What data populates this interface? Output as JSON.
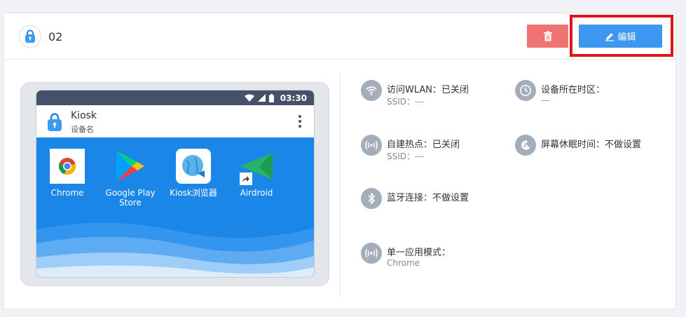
{
  "profile": {
    "name": "02"
  },
  "header": {
    "edit_label": "编辑"
  },
  "tablet": {
    "time": "03:30",
    "app_title": "Kiosk",
    "app_subtitle": "设备名",
    "apps": [
      {
        "label": "Chrome",
        "icon": "chrome-icon"
      },
      {
        "label": "Google Play Store",
        "icon": "google-play-icon"
      },
      {
        "label": "Kiosk浏览器",
        "icon": "kiosk-browser-icon"
      },
      {
        "label": "Airdroid",
        "icon": "airdroid-icon"
      }
    ]
  },
  "settings": {
    "wlan": {
      "title": "访问WLAN：已关闭",
      "sub": "SSID：---",
      "icon": "wifi-icon"
    },
    "timezone": {
      "title": "设备所在时区：",
      "sub": "---",
      "icon": "clock-icon"
    },
    "hotspot": {
      "title": "自建热点：已关闭",
      "sub": "SSID：---",
      "icon": "hotspot-icon"
    },
    "sleep": {
      "title": "屏幕休眠时间：不做设置",
      "icon": "moon-icon"
    },
    "bluetooth": {
      "title": "蓝牙连接：不做设置",
      "icon": "bluetooth-icon"
    },
    "single_app": {
      "title": "单一应用模式：",
      "sub": "Chrome",
      "icon": "single-app-icon"
    }
  },
  "colors": {
    "edit": "#3c97f0",
    "delete": "#f07373",
    "highlight": "#e0141e",
    "desktop": "#1a86e8",
    "statusbar": "#455069",
    "setting_icon": "#a4adba"
  }
}
